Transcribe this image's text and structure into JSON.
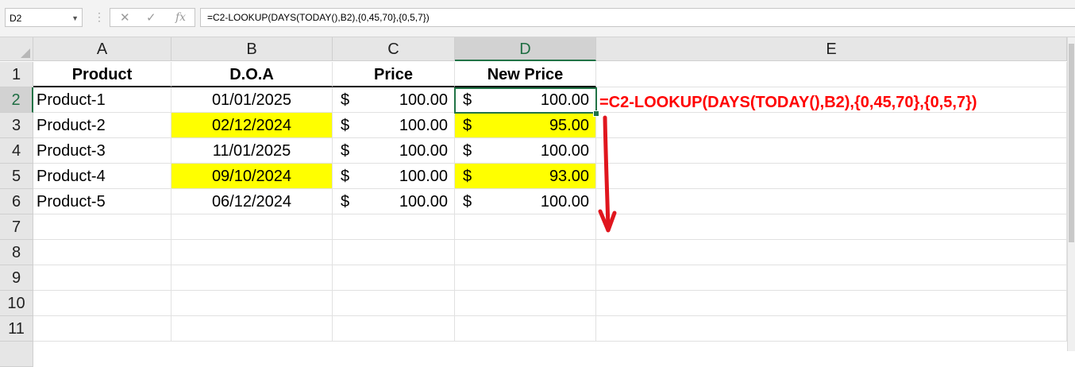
{
  "formula_bar": {
    "name_box": "D2",
    "cancel_icon": "✕",
    "enter_icon": "✓",
    "fx_icon": "fx",
    "formula": "=C2-LOOKUP(DAYS(TODAY(),B2),{0,45,70},{0,5,7})"
  },
  "columns": [
    "A",
    "B",
    "C",
    "D",
    "E"
  ],
  "row_numbers": [
    "1",
    "2",
    "3",
    "4",
    "5",
    "6",
    "7",
    "8",
    "9",
    "10",
    "11"
  ],
  "headers": {
    "a": "Product",
    "b": "D.O.A",
    "c": "Price",
    "d": "New Price"
  },
  "currency_symbol": "$",
  "rows": [
    {
      "product": "Product-1",
      "doa": "01/01/2025",
      "price": "100.00",
      "new_price": "100.00",
      "highlight": false
    },
    {
      "product": "Product-2",
      "doa": "02/12/2024",
      "price": "100.00",
      "new_price": "95.00",
      "highlight": true
    },
    {
      "product": "Product-3",
      "doa": "11/01/2025",
      "price": "100.00",
      "new_price": "100.00",
      "highlight": false
    },
    {
      "product": "Product-4",
      "doa": "09/10/2024",
      "price": "100.00",
      "new_price": "93.00",
      "highlight": true
    },
    {
      "product": "Product-5",
      "doa": "06/12/2024",
      "price": "100.00",
      "new_price": "100.00",
      "highlight": false
    }
  ],
  "annotation": "=C2-LOOKUP(DAYS(TODAY(),B2),{0,45,70},{0,5,7})",
  "colors": {
    "highlight": "#ffff00",
    "annotation": "#ff0000",
    "selection": "#217346"
  }
}
